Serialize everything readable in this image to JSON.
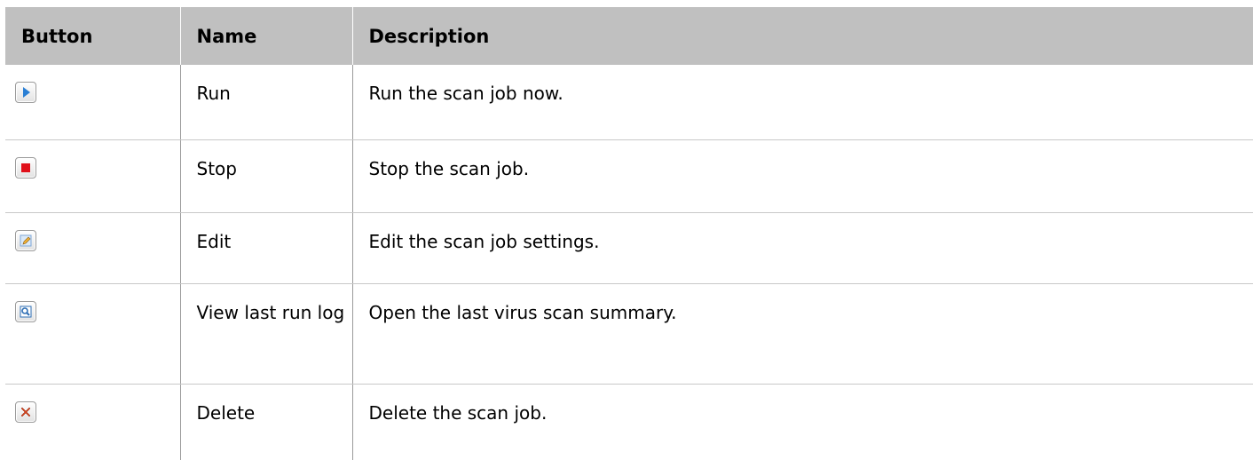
{
  "table": {
    "headers": [
      "Button",
      "Name",
      "Description"
    ],
    "rows": [
      {
        "icon": "run-icon",
        "name": "Run",
        "description": "Run the scan job now."
      },
      {
        "icon": "stop-icon",
        "name": "Stop",
        "description": "Stop the scan job."
      },
      {
        "icon": "edit-icon",
        "name": "Edit",
        "description": "Edit the scan job settings."
      },
      {
        "icon": "view-log-icon",
        "name": "View last run log",
        "description": "Open the last virus scan summary."
      },
      {
        "icon": "delete-icon",
        "name": "Delete",
        "description": "Delete the scan job."
      }
    ]
  },
  "colors": {
    "header_bg": "#c0c0c0",
    "run_icon": "#2a7fd4",
    "stop_icon": "#e0101a",
    "edit_icon": "#7fa8d8",
    "view_log_icon": "#2f6fb5",
    "delete_icon": "#d9431b"
  }
}
